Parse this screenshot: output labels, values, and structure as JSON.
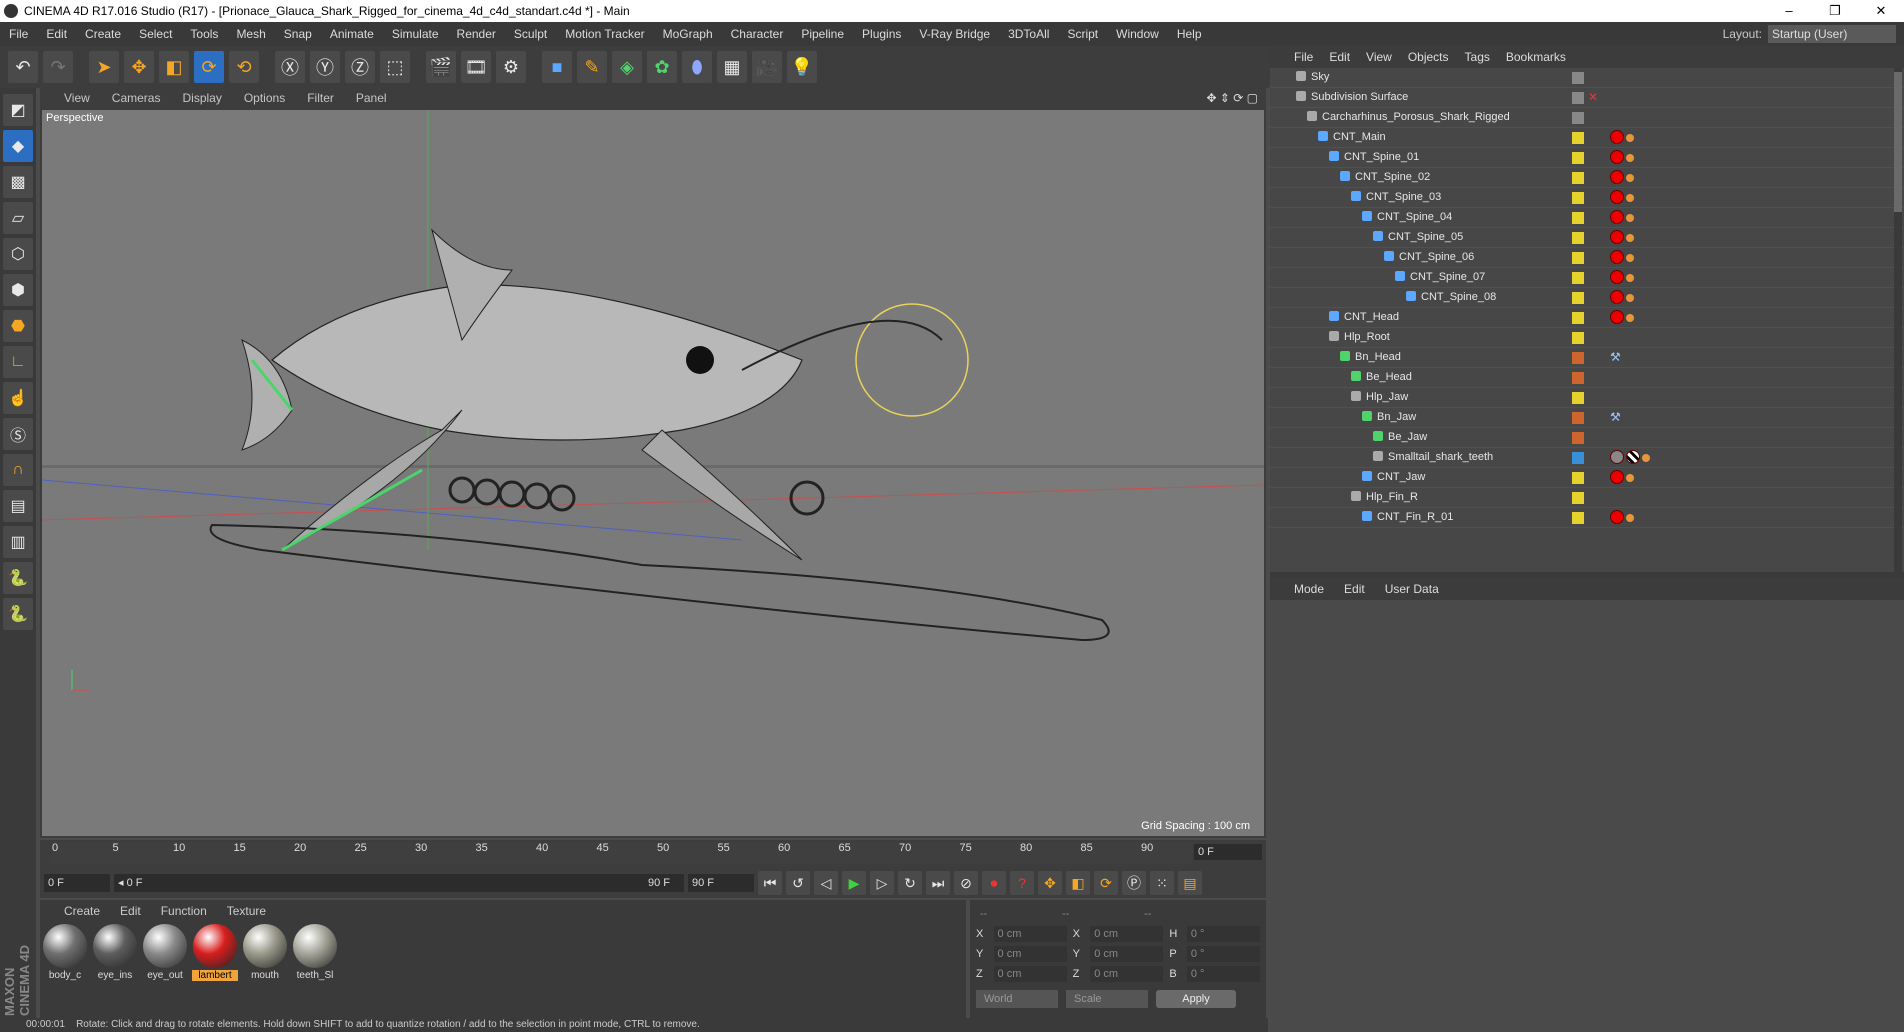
{
  "window": {
    "title": "CINEMA 4D R17.016 Studio (R17) - [Prionace_Glauca_Shark_Rigged_for_cinema_4d_c4d_standart.c4d *] - Main"
  },
  "menu": [
    "File",
    "Edit",
    "Create",
    "Select",
    "Tools",
    "Mesh",
    "Snap",
    "Animate",
    "Simulate",
    "Render",
    "Sculpt",
    "Motion Tracker",
    "MoGraph",
    "Character",
    "Pipeline",
    "Plugins",
    "V-Ray Bridge",
    "3DToAll",
    "Script",
    "Window",
    "Help"
  ],
  "layout": {
    "label": "Layout:",
    "value": "Startup (User)"
  },
  "viewport": {
    "menu": [
      "View",
      "Cameras",
      "Display",
      "Options",
      "Filter",
      "Panel"
    ],
    "label": "Perspective",
    "grid_spacing": "Grid Spacing : 100 cm"
  },
  "timeline": {
    "ticks": [
      "0",
      "5",
      "10",
      "15",
      "20",
      "25",
      "30",
      "35",
      "40",
      "45",
      "50",
      "55",
      "60",
      "65",
      "70",
      "75",
      "80",
      "85",
      "90"
    ],
    "frame_end_display": "0 F"
  },
  "transport": {
    "current": "0 F",
    "range_start": "◂ 0 F",
    "range_end": "90 F",
    "max": "90 F"
  },
  "materials": {
    "menu": [
      "Create",
      "Edit",
      "Function",
      "Texture"
    ],
    "items": [
      {
        "name": "body_c",
        "color": "#6f6f6f"
      },
      {
        "name": "eye_ins",
        "color": "#5d5d5d"
      },
      {
        "name": "eye_out",
        "color": "#8a8a8a"
      },
      {
        "name": "lambert",
        "color": "#d81e1e"
      },
      {
        "name": "mouth",
        "color": "#9b9a8c"
      },
      {
        "name": "teeth_Sl",
        "color": "#a5a59a"
      }
    ]
  },
  "coords": {
    "header": [
      "--",
      "--",
      "--"
    ],
    "rows": [
      {
        "a": "X",
        "av": "0 cm",
        "b": "X",
        "bv": "0 cm",
        "c": "H",
        "cv": "0 °"
      },
      {
        "a": "Y",
        "av": "0 cm",
        "b": "Y",
        "bv": "0 cm",
        "c": "P",
        "cv": "0 °"
      },
      {
        "a": "Z",
        "av": "0 cm",
        "b": "Z",
        "bv": "0 cm",
        "c": "B",
        "cv": "0 °"
      }
    ],
    "world": "World",
    "scale": "Scale",
    "apply": "Apply"
  },
  "status": {
    "time": "00:00:01",
    "text": "Rotate: Click and drag to rotate elements. Hold down SHIFT to add to quantize rotation / add to the selection in point mode, CTRL to remove."
  },
  "brand": "MAXON CINEMA 4D",
  "object_manager": {
    "menu": [
      "File",
      "Edit",
      "View",
      "Objects",
      "Tags",
      "Bookmarks"
    ],
    "objects": [
      {
        "name": "Sky",
        "depth": 0,
        "color": "#888888",
        "tag": "none"
      },
      {
        "name": "Subdivision Surface",
        "depth": 0,
        "color": "#888888",
        "tag": "x"
      },
      {
        "name": "Carcharhinus_Porosus_Shark_Rigged",
        "depth": 1,
        "color": "#888888",
        "tag": "none"
      },
      {
        "name": "CNT_Main",
        "depth": 2,
        "color": "#e6d22d",
        "tag": "red"
      },
      {
        "name": "CNT_Spine_01",
        "depth": 3,
        "color": "#e6d22d",
        "tag": "red"
      },
      {
        "name": "CNT_Spine_02",
        "depth": 4,
        "color": "#e6d22d",
        "tag": "red"
      },
      {
        "name": "CNT_Spine_03",
        "depth": 5,
        "color": "#e6d22d",
        "tag": "red"
      },
      {
        "name": "CNT_Spine_04",
        "depth": 6,
        "color": "#e6d22d",
        "tag": "red"
      },
      {
        "name": "CNT_Spine_05",
        "depth": 7,
        "color": "#e6d22d",
        "tag": "red"
      },
      {
        "name": "CNT_Spine_06",
        "depth": 8,
        "color": "#e6d22d",
        "tag": "red"
      },
      {
        "name": "CNT_Spine_07",
        "depth": 9,
        "color": "#e6d22d",
        "tag": "red"
      },
      {
        "name": "CNT_Spine_08",
        "depth": 10,
        "color": "#e6d22d",
        "tag": "red"
      },
      {
        "name": "CNT_Head",
        "depth": 3,
        "color": "#e6d22d",
        "tag": "red"
      },
      {
        "name": "Hlp_Root",
        "depth": 3,
        "color": "#e6d22d",
        "tag": "none"
      },
      {
        "name": "Bn_Head",
        "depth": 4,
        "color": "#d0642d",
        "tag": "ik"
      },
      {
        "name": "Be_Head",
        "depth": 5,
        "color": "#d0642d",
        "tag": "none"
      },
      {
        "name": "Hlp_Jaw",
        "depth": 5,
        "color": "#e6d22d",
        "tag": "none"
      },
      {
        "name": "Bn_Jaw",
        "depth": 6,
        "color": "#d0642d",
        "tag": "ik"
      },
      {
        "name": "Be_Jaw",
        "depth": 7,
        "color": "#d0642d",
        "tag": "none"
      },
      {
        "name": "Smalltail_shark_teeth",
        "depth": 7,
        "color": "#3a8fd9",
        "tag": "mat"
      },
      {
        "name": "CNT_Jaw",
        "depth": 6,
        "color": "#e6d22d",
        "tag": "red"
      },
      {
        "name": "Hlp_Fin_R",
        "depth": 5,
        "color": "#e6d22d",
        "tag": "none"
      },
      {
        "name": "CNT_Fin_R_01",
        "depth": 6,
        "color": "#e6d22d",
        "tag": "red"
      }
    ]
  },
  "attribute_manager": {
    "menu": [
      "Mode",
      "Edit",
      "User Data"
    ]
  }
}
